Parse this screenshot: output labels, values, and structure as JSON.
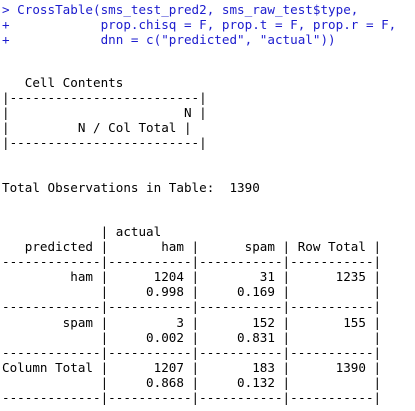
{
  "theme": {
    "input_color": "#1c1cce",
    "output_color": "#000000",
    "background": "#ffffff"
  },
  "console": {
    "command": [
      "> CrossTable(sms_test_pred2, sms_raw_test$type,",
      "+            prop.chisq = F, prop.t = F, prop.r = F,",
      "+            dnn = c(\"predicted\", \"actual\"))"
    ],
    "cell_contents": {
      "title": "   Cell Contents",
      "box": [
        "|-------------------------|",
        "|                       N |",
        "|         N / Col Total |",
        "|-------------------------|"
      ]
    },
    "total_observations": "Total Observations in Table:  1390",
    "table": {
      "header": [
        "             | actual",
        "   predicted |       ham |      spam | Row Total |"
      ],
      "rule": "-------------|-----------|-----------|-----------|",
      "rows": [
        {
          "line1": "         ham |      1204 |        31 |      1235 |",
          "line2": "             |     0.998 |     0.169 |           |"
        },
        {
          "line1": "        spam |         3 |       152 |       155 |",
          "line2": "             |     0.002 |     0.831 |           |"
        }
      ],
      "total": {
        "line1": "Column Total |      1207 |       183 |      1390 |",
        "line2": "             |     0.868 |     0.132 |           |"
      }
    }
  }
}
